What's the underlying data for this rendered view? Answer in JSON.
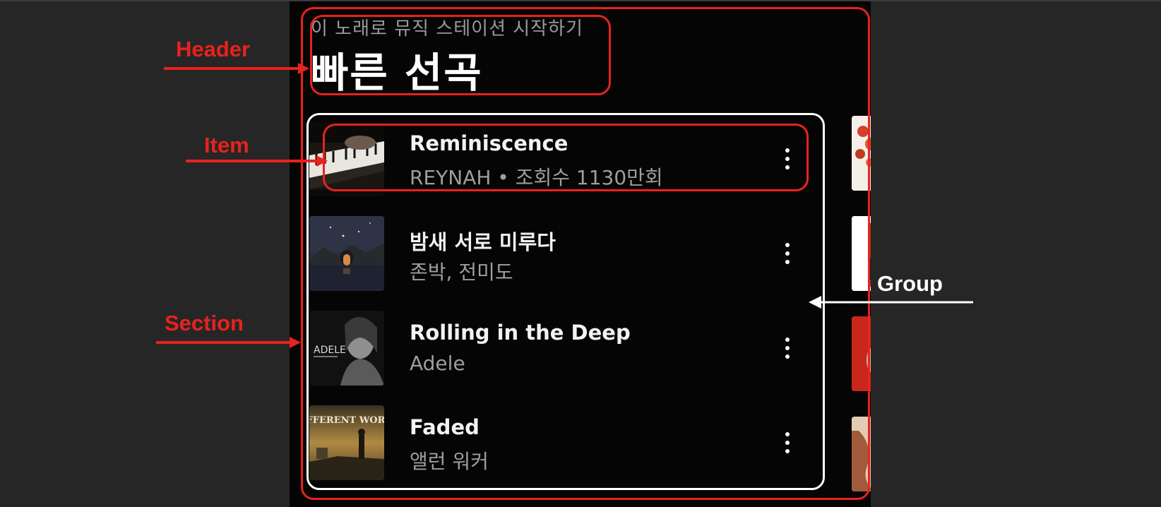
{
  "header": {
    "subtitle": "이 노래로 뮤직 스테이션 시작하기",
    "title": "빠른 선곡"
  },
  "songs": [
    {
      "title": "Reminiscence",
      "subtitle": "REYNAH • 조회수 1130만회",
      "thumb_icon": "piano-keys-art"
    },
    {
      "title": "밤새 서로 미루다",
      "subtitle": "존박, 전미도",
      "thumb_icon": "night-landscape-art"
    },
    {
      "title": "Rolling in the Deep",
      "subtitle": "Adele",
      "thumb_icon": "adele-portrait-art",
      "thumb_text": "ADELE"
    },
    {
      "title": "Faded",
      "subtitle": "앨런 워커",
      "thumb_icon": "different-world-art",
      "thumb_text": "DIFFERENT WORLD"
    }
  ],
  "annotations": {
    "header": "Header",
    "item": "Item",
    "section": "Section",
    "group": "Group"
  },
  "colors": {
    "annotation_red": "#e8221d",
    "annotation_white": "#ffffff",
    "background": "#050505",
    "title_text": "#ffffff",
    "secondary_text": "#9e9e9e"
  }
}
